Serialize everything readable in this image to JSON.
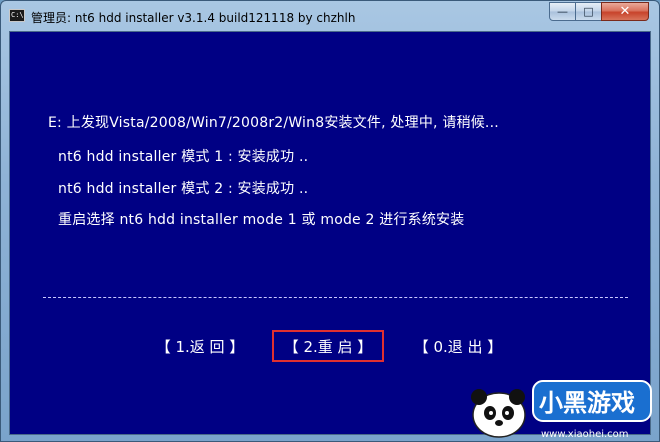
{
  "window": {
    "title": "管理员:  nt6 hdd installer v3.1.4 build121118 by chzhlh",
    "app_icon_label": "C:\\",
    "controls": {
      "minimize": "—",
      "maximize": "□",
      "close": "✕"
    }
  },
  "console": {
    "lines": [
      "E: 上发现Vista/2008/Win7/2008r2/Win8安装文件, 处理中, 请稍候...",
      "nt6 hdd installer 模式 1 : 安装成功 ..",
      "nt6 hdd installer 模式 2 : 安装成功 ..",
      "重启选择 nt6 hdd installer mode 1 或 mode 2 进行系统安装"
    ],
    "menu": [
      {
        "label": "【 1.返 回 】",
        "selected": false
      },
      {
        "label": "【 2.重 启 】",
        "selected": true
      },
      {
        "label": "【 0.退 出 】",
        "selected": false
      }
    ]
  },
  "watermark": {
    "brand": "小黑游戏",
    "url": "www.xiaohei.com"
  },
  "colors": {
    "console_bg": "#000084",
    "console_text": "#ffffff",
    "selection_border": "#e03030"
  }
}
